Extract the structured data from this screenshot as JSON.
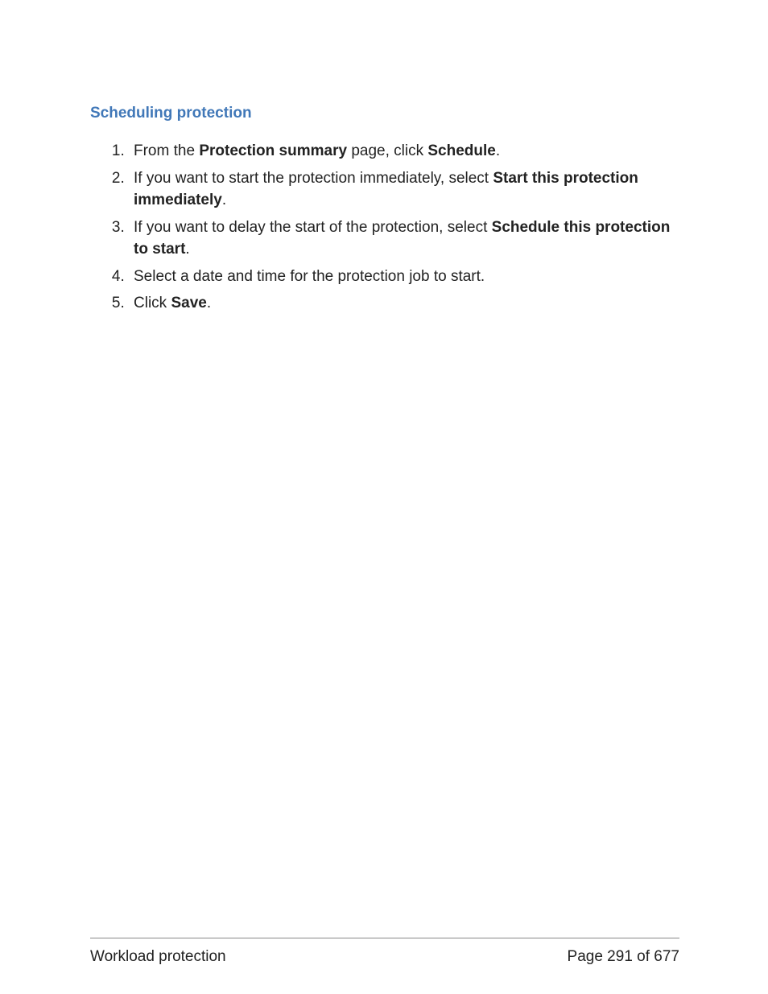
{
  "heading": "Scheduling protection",
  "steps": {
    "s1a": "From the ",
    "s1b": "Protection summary",
    "s1c": " page, click ",
    "s1d": "Schedule",
    "s1e": ".",
    "s2a": "If you want to start the protection immediately, select ",
    "s2b": "Start this protection immediately",
    "s2c": ".",
    "s3a": "If you want to delay the start of the protection, select ",
    "s3b": "Schedule this protection to start",
    "s3c": ".",
    "s4": "Select a date and time for the protection job to start.",
    "s5a": "Click ",
    "s5b": "Save",
    "s5c": "."
  },
  "footer": {
    "left": "Workload protection",
    "right": "Page 291 of 677"
  }
}
